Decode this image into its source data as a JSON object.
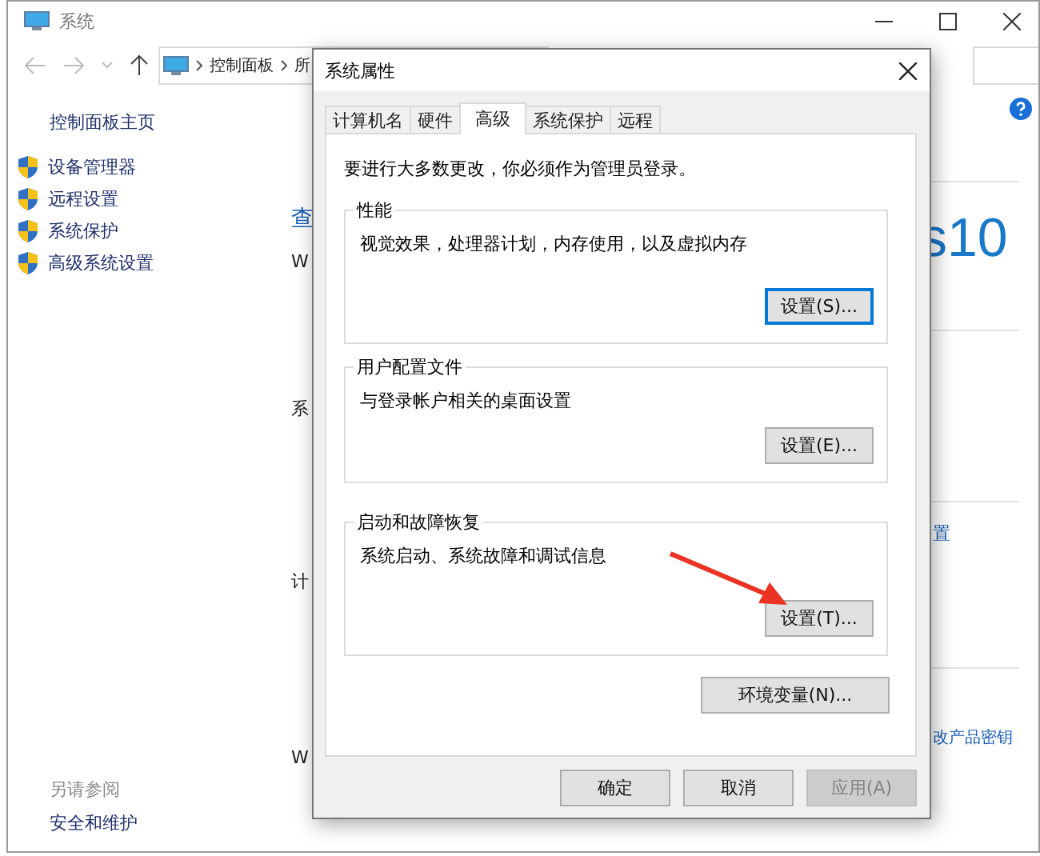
{
  "window": {
    "title": "系统",
    "address": [
      "控制面板",
      "所"
    ]
  },
  "sidebar": {
    "home": "控制面板主页",
    "items": [
      "设备管理器",
      "远程设置",
      "系统保护",
      "高级系统设置"
    ],
    "see_also": {
      "heading": "另请参阅",
      "links": [
        "安全和维护"
      ]
    }
  },
  "content": {
    "fragments": [
      {
        "text": "查",
        "kind": "link"
      },
      {
        "text": "W",
        "kind": "text"
      },
      {
        "text": "系",
        "kind": "text"
      },
      {
        "text": "计",
        "kind": "text"
      },
      {
        "text": "W",
        "kind": "text"
      }
    ],
    "edition": "s10",
    "links": [
      "置",
      "改产品密钥"
    ]
  },
  "dialog": {
    "title": "系统属性",
    "tabs": [
      {
        "label": "计算机名",
        "selected": false
      },
      {
        "label": "硬件",
        "selected": false
      },
      {
        "label": "高级",
        "selected": true
      },
      {
        "label": "系统保护",
        "selected": false
      },
      {
        "label": "远程",
        "selected": false
      }
    ],
    "notice": "要进行大多数更改，你必须作为管理员登录。",
    "groups": [
      {
        "title": "性能",
        "description": "视觉效果，处理器计划，内存使用，以及虚拟内存",
        "button": "设置(S)...",
        "focused": true
      },
      {
        "title": "用户配置文件",
        "description": "与登录帐户相关的桌面设置",
        "button": "设置(E)...",
        "focused": false
      },
      {
        "title": "启动和故障恢复",
        "description": "系统启动、系统故障和调试信息",
        "button": "设置(T)...",
        "focused": false
      }
    ],
    "env_button": "环境变量(N)...",
    "buttons": [
      {
        "label": "确定",
        "disabled": false
      },
      {
        "label": "取消",
        "disabled": false
      },
      {
        "label": "应用(A)",
        "disabled": true
      }
    ]
  },
  "annotations": [
    {
      "kind": "arrow"
    }
  ]
}
